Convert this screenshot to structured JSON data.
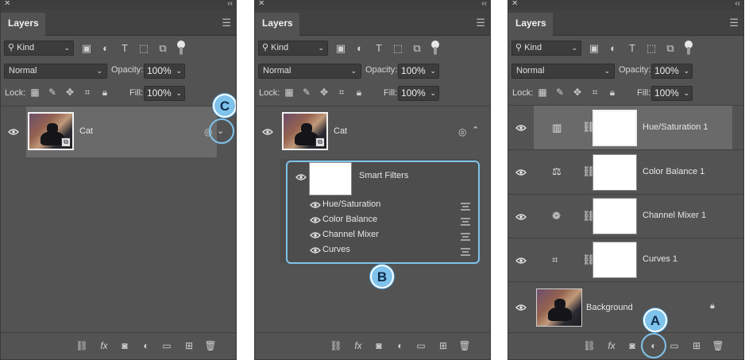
{
  "panels": [
    {
      "tab_label": "Layers",
      "kind_label": "Kind",
      "blend_mode": "Normal",
      "opacity_label": "Opacity:",
      "opacity_value": "100%",
      "lock_label": "Lock:",
      "fill_label": "Fill:",
      "fill_value": "100%",
      "layers": [
        {
          "name": "Cat"
        }
      ],
      "callout": "C"
    },
    {
      "tab_label": "Layers",
      "kind_label": "Kind",
      "blend_mode": "Normal",
      "opacity_label": "Opacity:",
      "opacity_value": "100%",
      "lock_label": "Lock:",
      "fill_label": "Fill:",
      "fill_value": "100%",
      "layers": [
        {
          "name": "Cat"
        }
      ],
      "smart_filters_label": "Smart Filters",
      "filters": [
        {
          "name": "Hue/Saturation"
        },
        {
          "name": "Color Balance"
        },
        {
          "name": "Channel Mixer"
        },
        {
          "name": "Curves"
        }
      ],
      "callout": "B"
    },
    {
      "tab_label": "Layers",
      "kind_label": "Kind",
      "blend_mode": "Normal",
      "opacity_label": "Opacity:",
      "opacity_value": "100%",
      "lock_label": "Lock:",
      "fill_label": "Fill:",
      "fill_value": "100%",
      "layers": [
        {
          "name": "Hue/Saturation 1",
          "icon": "hue-saturation-icon"
        },
        {
          "name": "Color Balance 1",
          "icon": "color-balance-icon"
        },
        {
          "name": "Channel Mixer 1",
          "icon": "channel-mixer-icon"
        },
        {
          "name": "Curves 1",
          "icon": "curves-icon"
        },
        {
          "name": "Background"
        }
      ],
      "callout": "A"
    }
  ],
  "colors": {
    "panel_bg": "#535353",
    "selected_row": "#6a6a6a",
    "callout": "#7fc3ec"
  }
}
